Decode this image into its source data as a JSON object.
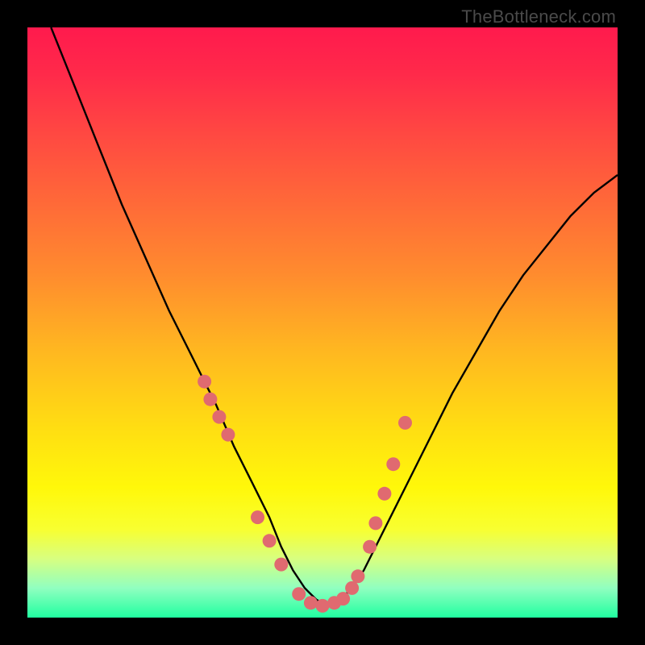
{
  "watermark": "TheBottleneck.com",
  "chart_data": {
    "type": "line",
    "title": "",
    "xlabel": "",
    "ylabel": "",
    "xlim": [
      0,
      100
    ],
    "ylim": [
      0,
      100
    ],
    "series": [
      {
        "name": "curve",
        "x": [
          4,
          8,
          12,
          16,
          20,
          24,
          28,
          32,
          35,
          38,
          41,
          43,
          45,
          47,
          49,
          51,
          53,
          55,
          57,
          60,
          64,
          68,
          72,
          76,
          80,
          84,
          88,
          92,
          96,
          100
        ],
        "y": [
          100,
          90,
          80,
          70,
          61,
          52,
          44,
          36,
          29,
          23,
          17,
          12,
          8,
          5,
          3,
          2,
          3,
          5,
          8,
          14,
          22,
          30,
          38,
          45,
          52,
          58,
          63,
          68,
          72,
          75
        ]
      }
    ],
    "markers": {
      "name": "dots",
      "x": [
        30,
        31,
        32.5,
        34,
        39,
        41,
        43,
        46,
        48,
        50,
        52,
        53.5,
        55,
        56,
        58,
        59,
        60.5,
        62,
        64
      ],
      "y": [
        40,
        37,
        34,
        31,
        17,
        13,
        9,
        4,
        2.5,
        2,
        2.5,
        3.2,
        5,
        7,
        12,
        16,
        21,
        26,
        33
      ]
    }
  }
}
